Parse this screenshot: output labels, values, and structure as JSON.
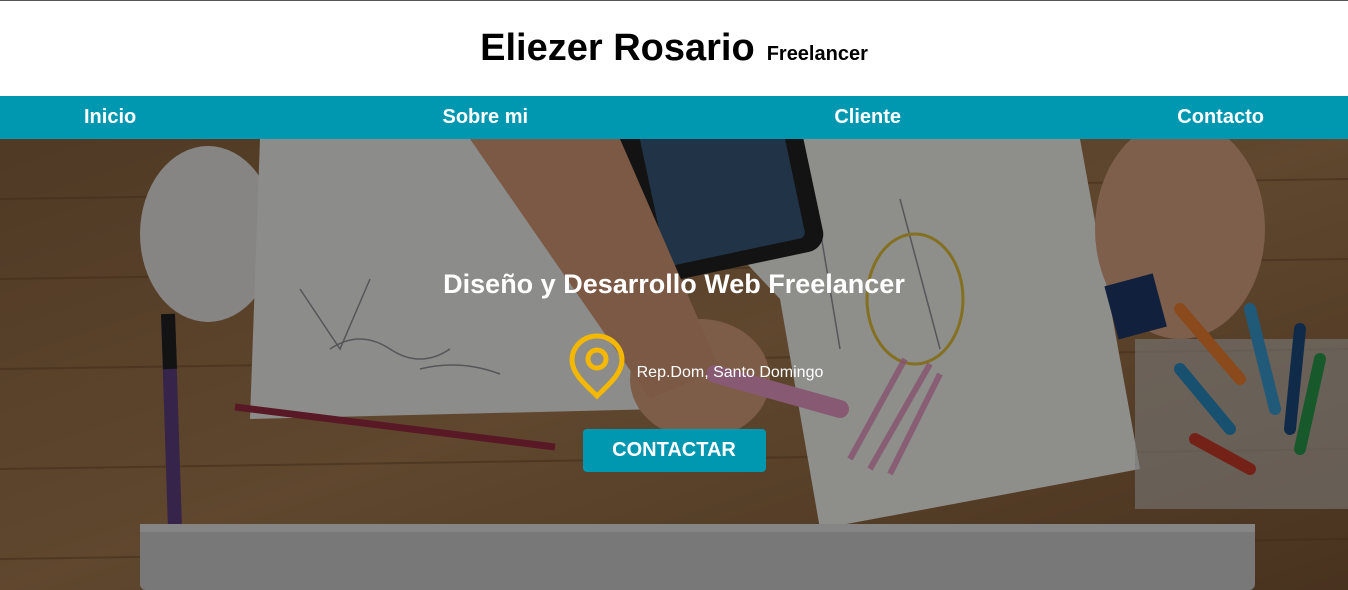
{
  "header": {
    "title": "Eliezer Rosario",
    "subtitle": "Freelancer"
  },
  "nav": {
    "items": [
      {
        "label": "Inicio"
      },
      {
        "label": "Sobre mi"
      },
      {
        "label": "Cliente"
      },
      {
        "label": "Contacto"
      }
    ]
  },
  "hero": {
    "title": "Diseño y Desarrollo Web Freelancer",
    "location_icon": "map-pin-icon",
    "location": "Rep.Dom, Santo Domingo",
    "cta_label": "CONTACTAR"
  },
  "colors": {
    "accent": "#0097b0",
    "pin": "#f5b800"
  }
}
